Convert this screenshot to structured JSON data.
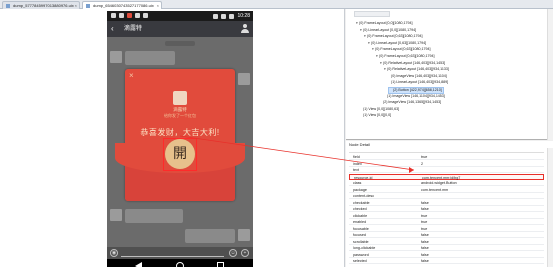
{
  "tabs": [
    {
      "label": "dump_5777845997013880976.uix",
      "active": false
    },
    {
      "label": "dump_6546030743527177086.uix",
      "active": true
    }
  ],
  "phone": {
    "status_time": "10:28",
    "chat_title": "滴露特",
    "envelope": {
      "sender": "滴露特",
      "subtitle": "给你发了一个红包",
      "greeting": "恭喜发财，大吉大利!",
      "open_button": "開",
      "close_glyph": "×"
    }
  },
  "tree": {
    "rows": [
      "(0) FrameLayout [0,0][1080,1794]",
      "(0) LinearLayout [0,0][1080,1794]",
      "(0) FrameLayout [0,63][1080,1794]",
      "(0) LinearLayout [0,63][1080,1794]",
      "(0) FrameLayout [0,63][1080,1794]",
      "(0) FrameLayout [0,63][1080,1794]",
      "(0) RelativeLayout [146,403][934,1453]",
      "(0) RelativeLayout [146,403][934,1133]",
      "(0) ImageView [146,403][934,1104]",
      "(1) LinearLayout [146,403][934,889]",
      "(2) Button [422,974][658,1210]",
      "(1) ImageView [146,1104][934,1453]",
      "(2) ImageView [146,1365][934,1453]",
      "(1) View [0,0][1080,63]",
      "(1) View [0,0][0,0]"
    ],
    "selected_index": 10
  },
  "detail": {
    "title": "Node Detail",
    "properties": [
      {
        "key": "field",
        "value": "true"
      },
      {
        "key": "index",
        "value": "2"
      },
      {
        "key": "text",
        "value": ""
      },
      {
        "key": "resource-id",
        "value": "com.tencent.mm:id/bg7"
      },
      {
        "key": "class",
        "value": "android.widget.Button"
      },
      {
        "key": "package",
        "value": "com.tencent.mm"
      },
      {
        "key": "content-desc",
        "value": ""
      },
      {
        "key": "checkable",
        "value": "false"
      },
      {
        "key": "checked",
        "value": "false"
      },
      {
        "key": "clickable",
        "value": "true"
      },
      {
        "key": "enabled",
        "value": "true"
      },
      {
        "key": "focusable",
        "value": "true"
      },
      {
        "key": "focused",
        "value": "false"
      },
      {
        "key": "scrollable",
        "value": "false"
      },
      {
        "key": "long-clickable",
        "value": "false"
      },
      {
        "key": "password",
        "value": "false"
      },
      {
        "key": "selected",
        "value": "false"
      }
    ],
    "highlight_index": 3
  },
  "colors": {
    "envelope_red": "#e14b3c",
    "open_button_gold": "#e7c18c",
    "highlight_red": "#e8302a",
    "selection_blue": "#cfe3fb"
  }
}
